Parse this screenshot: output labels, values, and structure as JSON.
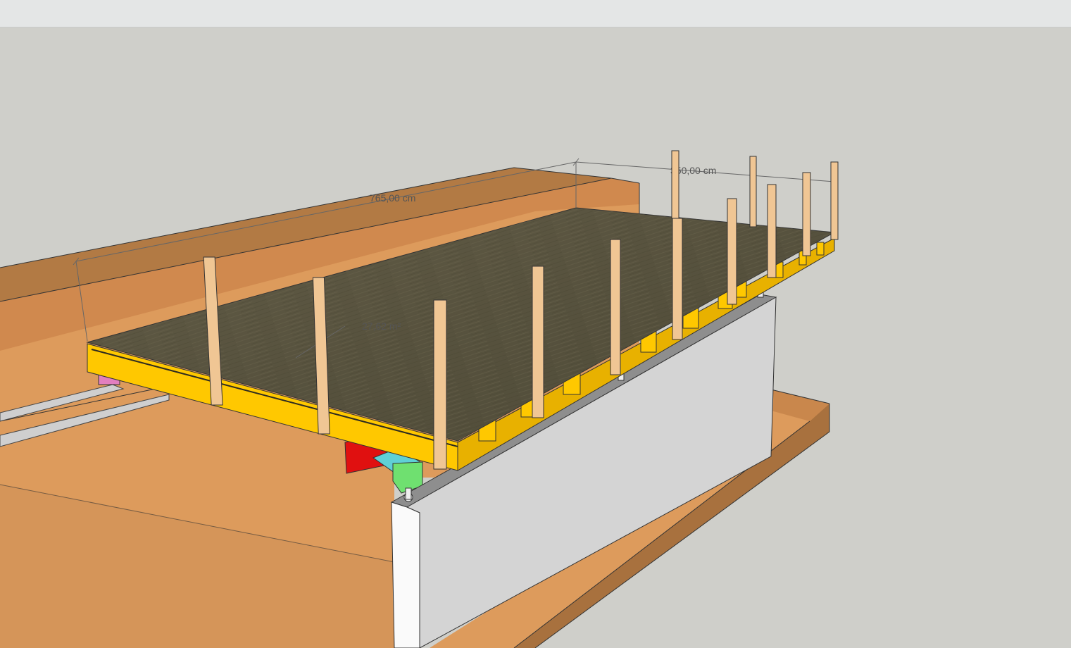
{
  "scene": {
    "dimensions": {
      "length_label": "765,00 cm",
      "width_label": "350,00 cm",
      "area_label": "27,62 m²"
    }
  },
  "colors": {
    "background": "#cfcfca",
    "toolbar": "#e4e6e6",
    "terrain": "#dd9b5c",
    "terrain_dark": "#b07843",
    "beam_yellow": "#ffc800",
    "deck_surface": "#5d5843",
    "post_wood": "#f0c694",
    "wall_white": "#d6d6d6"
  }
}
